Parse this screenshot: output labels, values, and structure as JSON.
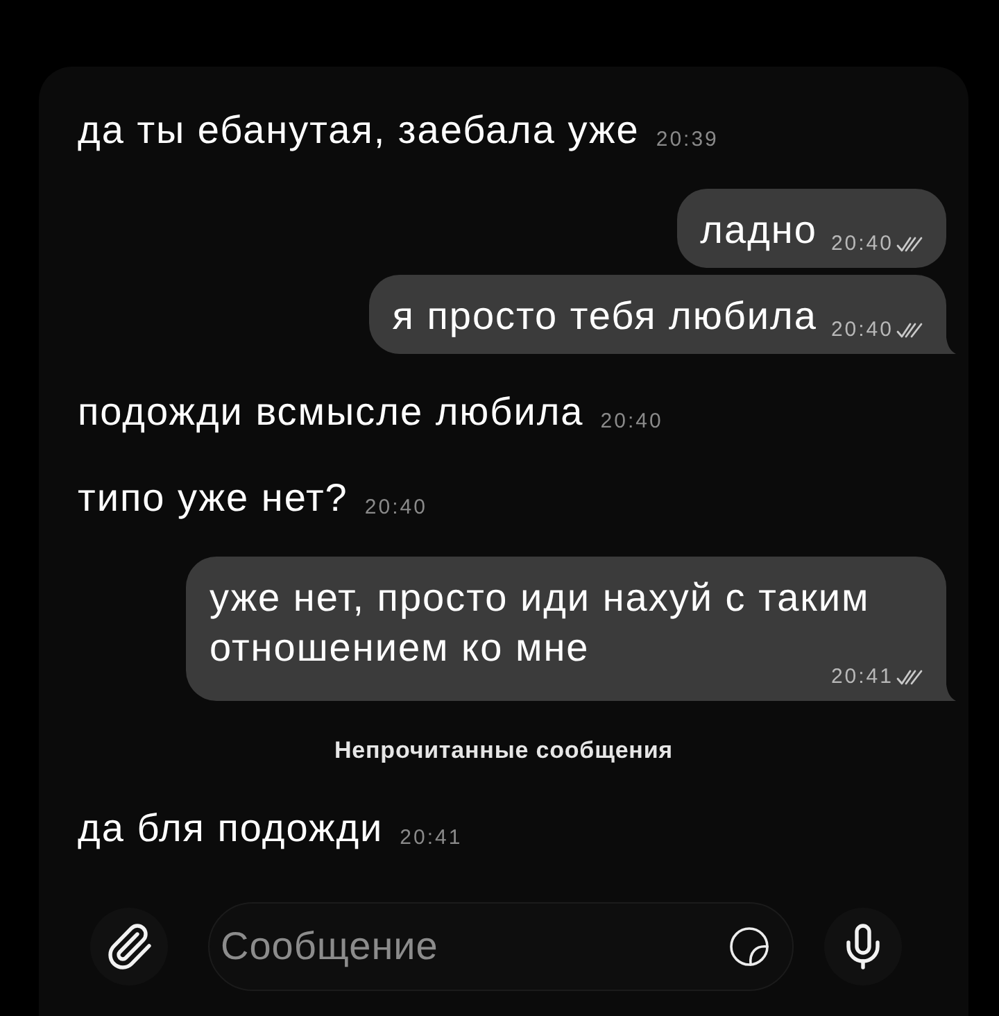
{
  "chat": {
    "items": [
      {
        "kind": "incoming",
        "text": "да ты ебанутая, заебала уже",
        "time": "20:39"
      },
      {
        "kind": "outgoing",
        "text": "ладно",
        "time": "20:40",
        "read": true
      },
      {
        "kind": "outgoing",
        "text": "я просто тебя любила",
        "time": "20:40",
        "read": true
      },
      {
        "kind": "incoming",
        "text": "подожди всмысле любила",
        "time": "20:40"
      },
      {
        "kind": "incoming",
        "text": "типо уже нет?",
        "time": "20:40"
      },
      {
        "kind": "outgoing",
        "text": "уже нет, просто иди нахуй с таким отношением ко мне",
        "time": "20:41",
        "read": true
      },
      {
        "kind": "divider",
        "text": "Непрочитанные сообщения"
      },
      {
        "kind": "incoming",
        "text": "да бля подожди",
        "time": "20:41"
      }
    ]
  },
  "composer": {
    "placeholder": "Сообщение"
  }
}
